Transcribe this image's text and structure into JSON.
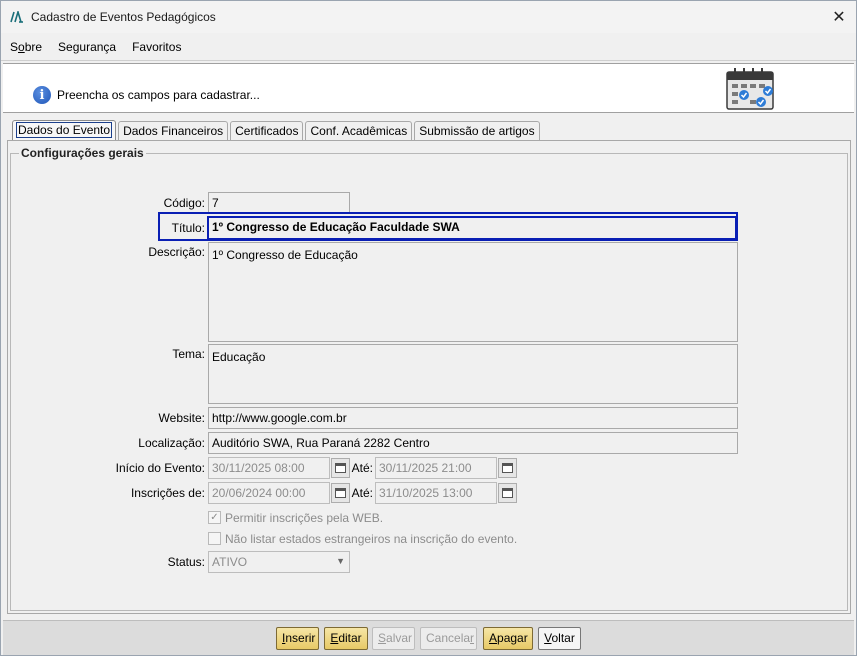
{
  "window": {
    "title": "Cadastro de Eventos Pedagógicos",
    "close_glyph": "✕"
  },
  "menu": [
    {
      "pre": "S",
      "ul": "o",
      "post": "bre"
    },
    {
      "pre": "",
      "ul": "",
      "post": "Segurança"
    },
    {
      "pre": "",
      "ul": "",
      "post": "Favoritos"
    }
  ],
  "header": {
    "info_text": "Preencha os campos para cadastrar...",
    "icon": "calendar-check-icon"
  },
  "tabs": [
    "Dados do Evento",
    "Dados Financeiros",
    "Certificados",
    "Conf. Acadêmicas",
    "Submissão de artigos"
  ],
  "group": {
    "title": "Configurações gerais"
  },
  "form": {
    "codigo_label": "Código:",
    "codigo": "7",
    "titulo_label": "Título:",
    "titulo": "1º Congresso de Educação Faculdade SWA",
    "descricao_label": "Descrição:",
    "descricao": "1º Congresso de Educação",
    "tema_label": "Tema:",
    "tema": "Educação",
    "website_label": "Website:",
    "website": "http://www.google.com.br",
    "localizacao_label": "Localização:",
    "localizacao": "Auditório SWA, Rua Paraná 2282 Centro",
    "inicio_label": "Início do Evento:",
    "inicio": "30/11/2025 08:00",
    "ate_label": "Até:",
    "inicio_ate": "30/11/2025 21:00",
    "inscricoes_label": "Inscrições de:",
    "inscricoes": "20/06/2024 00:00",
    "inscricoes_ate": "31/10/2025 13:00",
    "permitir_label": "Permitir inscrições pela WEB.",
    "permitir_checked": true,
    "nao_listar_label": "Não listar estados estrangeiros na inscrição do evento.",
    "nao_listar_checked": false,
    "status_label": "Status:",
    "status": "ATIVO"
  },
  "buttons": [
    {
      "pre": "",
      "ul": "I",
      "post": "nserir",
      "state": "active"
    },
    {
      "pre": "",
      "ul": "E",
      "post": "ditar",
      "state": "active"
    },
    {
      "pre": "",
      "ul": "S",
      "post": "alvar",
      "state": "inactive"
    },
    {
      "pre": "Cancela",
      "ul": "r",
      "post": "",
      "state": "inactive"
    },
    {
      "pre": "",
      "ul": "A",
      "post": "pagar",
      "state": "active"
    },
    {
      "pre": "",
      "ul": "V",
      "post": "oltar",
      "state": "plain"
    }
  ]
}
